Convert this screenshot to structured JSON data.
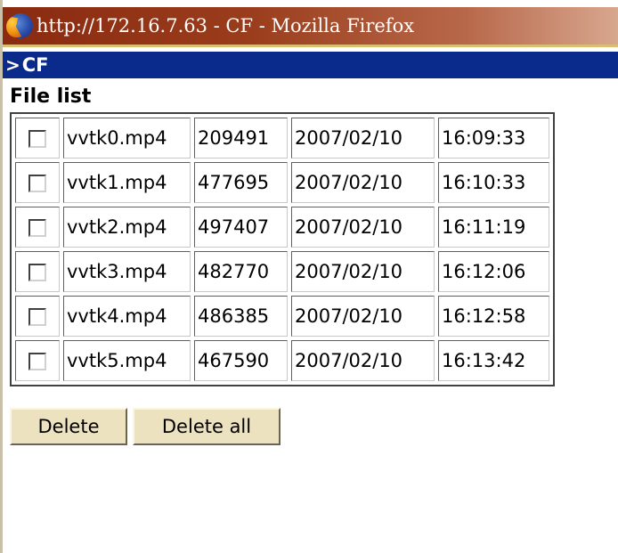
{
  "window": {
    "title": "http://172.16.7.63 - CF - Mozilla Firefox",
    "icon": "firefox-icon"
  },
  "section_bar": {
    "arrow": ">",
    "label": "CF"
  },
  "file_list": {
    "heading": "File list",
    "rows": [
      {
        "name": "vvtk0.mp4",
        "size": "209491",
        "date": "2007/02/10",
        "time": "16:09:33",
        "checked": false
      },
      {
        "name": "vvtk1.mp4",
        "size": "477695",
        "date": "2007/02/10",
        "time": "16:10:33",
        "checked": false
      },
      {
        "name": "vvtk2.mp4",
        "size": "497407",
        "date": "2007/02/10",
        "time": "16:11:19",
        "checked": false
      },
      {
        "name": "vvtk3.mp4",
        "size": "482770",
        "date": "2007/02/10",
        "time": "16:12:06",
        "checked": false
      },
      {
        "name": "vvtk4.mp4",
        "size": "486385",
        "date": "2007/02/10",
        "time": "16:12:58",
        "checked": false
      },
      {
        "name": "vvtk5.mp4",
        "size": "467590",
        "date": "2007/02/10",
        "time": "16:13:42",
        "checked": false
      }
    ]
  },
  "actions": {
    "delete_label": "Delete",
    "delete_all_label": "Delete all"
  },
  "colors": {
    "section_bar": "#0a2a8c",
    "button_face": "#ece2c0",
    "titlebar": "#8a2a10"
  }
}
